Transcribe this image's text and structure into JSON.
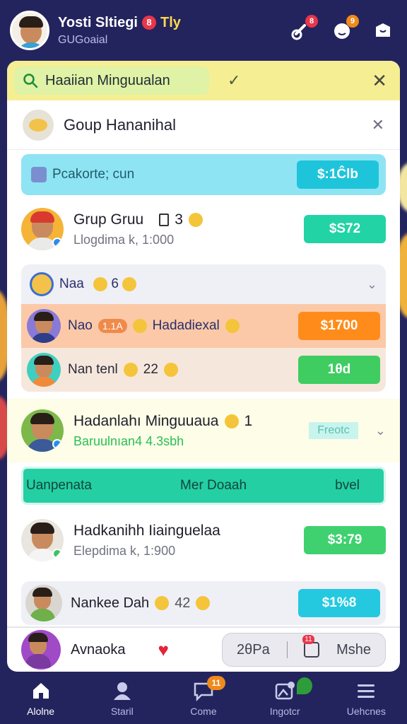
{
  "header": {
    "user_name": "Yosti Sltiegi",
    "user_flag": "Tly",
    "user_badge": "8",
    "user_sub": "GUGoaial",
    "icon_badges": [
      "8",
      "9"
    ]
  },
  "search": {
    "value": "Haaiian Minguualan"
  },
  "group": {
    "title": "Goup Hananihal"
  },
  "banner": {
    "text": "Pcakorte; cun",
    "price": "$:1Ĉlb"
  },
  "rows": [
    {
      "name": "Grup Gruu",
      "meta": "3",
      "sub": "Llogdima k, 1:000",
      "price": "$S72"
    }
  ],
  "nested_group": {
    "title": "Naa",
    "title_meta": "6",
    "items": [
      {
        "label": "Nao",
        "pill": "1.1A",
        "label2": "Hadadiexal",
        "price": "$1700"
      },
      {
        "label": "Nan tenl",
        "meta": "22",
        "price": "1θd"
      }
    ]
  },
  "highlight": {
    "name": "Hadanlahı Minguuaua",
    "meta": "1",
    "sub": "Baruulnıan4 4.3sbh",
    "tag": "Freotc"
  },
  "green_bar": {
    "left": "Uanpenata",
    "center": "Mer Doaah",
    "right": "bvel"
  },
  "row3": {
    "name": "Hadkanihh Iiainguelaa",
    "sub": "Elepdima k, 1:900",
    "price": "$3:79"
  },
  "row4": {
    "name": "Nankee Dah",
    "meta": "42",
    "price": "$1%8"
  },
  "bottom_strip": {
    "name": "Avnaoka",
    "compose_left": "2θPa",
    "compose_badge": "11",
    "compose_right": "Mshe"
  },
  "nav": [
    {
      "label": "Alolne",
      "icon": "home-icon",
      "active": true
    },
    {
      "label": "Staril",
      "icon": "person-icon"
    },
    {
      "label": "Come",
      "icon": "chat-icon",
      "badge": "11"
    },
    {
      "label": "Ingotcr",
      "icon": "image-icon"
    },
    {
      "label": "Uehcnes",
      "icon": "menu-icon"
    }
  ]
}
